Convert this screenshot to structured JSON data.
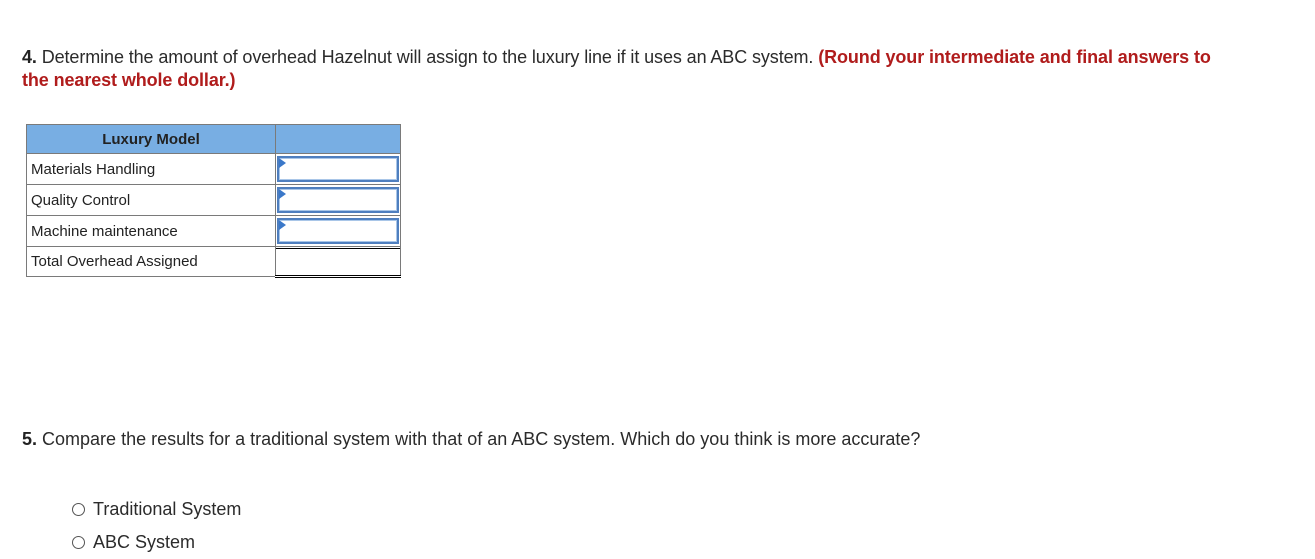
{
  "question4": {
    "number": "4.",
    "text": "Determine the amount of overhead Hazelnut will assign to the luxury line if it uses an ABC system.",
    "instruction": "(Round your intermediate and final answers to the nearest whole dollar.)"
  },
  "table": {
    "header": {
      "label": "Luxury  Model",
      "value": ""
    },
    "rows": [
      {
        "label": "Materials Handling",
        "value": "",
        "input": true
      },
      {
        "label": "Quality Control",
        "value": "",
        "input": true
      },
      {
        "label": "Machine maintenance",
        "value": "",
        "input": true
      }
    ],
    "total": {
      "label": "Total Overhead Assigned",
      "value": ""
    }
  },
  "question5": {
    "number": "5.",
    "text": "Compare the results for a traditional system with that of an ABC system. Which do you think is more accurate?",
    "options": [
      {
        "label": "Traditional System",
        "selected": false
      },
      {
        "label": "ABC System",
        "selected": false
      }
    ]
  },
  "colors": {
    "header_bg": "#78aee3",
    "instruction_red": "#b01c1c",
    "input_border": "#4f7fbf"
  }
}
